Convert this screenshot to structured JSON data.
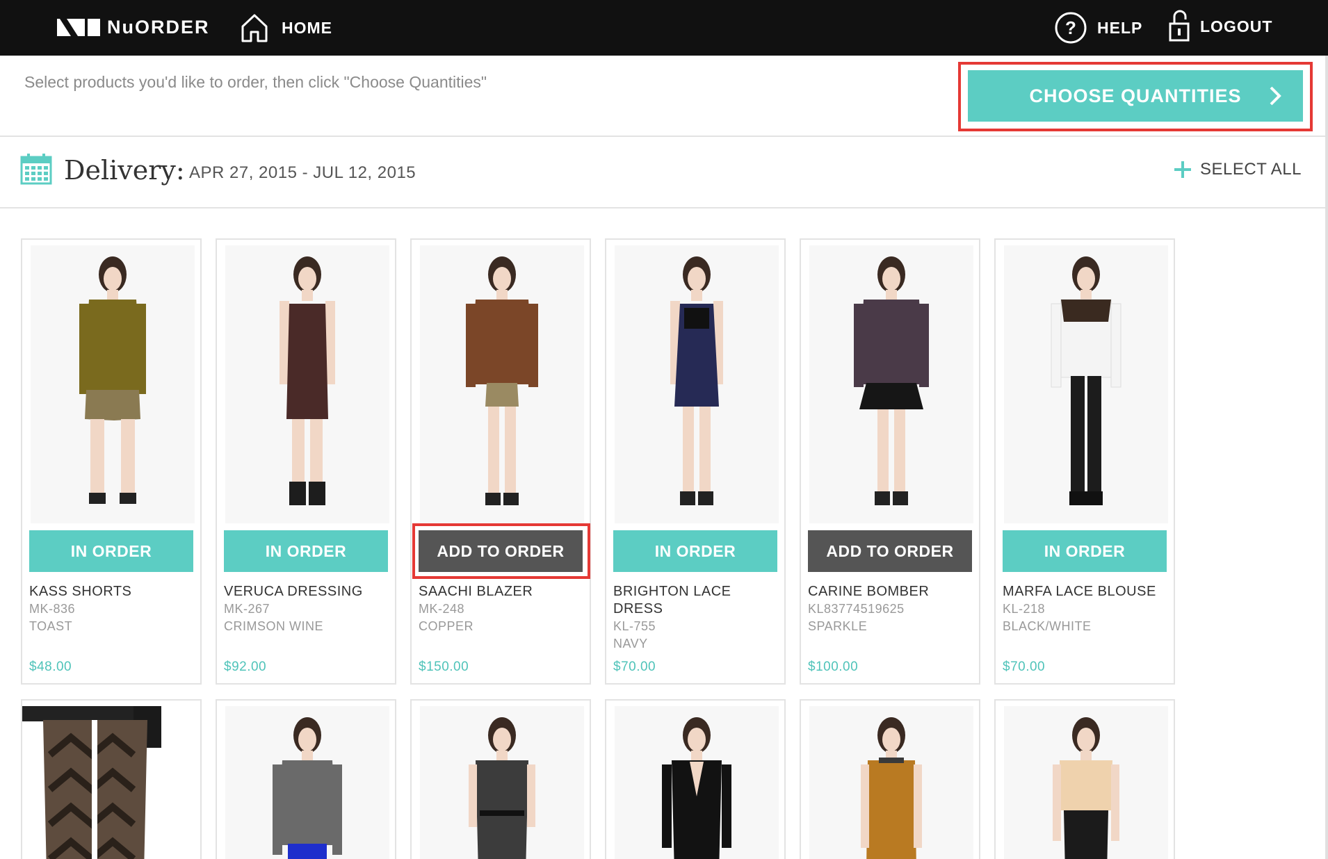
{
  "nav": {
    "brand_prefix": "Nu",
    "brand_suffix": "ORDER",
    "home_label": "HOME",
    "help_label": "HELP",
    "logout_label": "LOGOUT"
  },
  "toolbar": {
    "instruction": "Select products you'd like to order, then click \"Choose Quantities\"",
    "choose_quantities_label": "CHOOSE QUANTITIES"
  },
  "delivery": {
    "label": "Delivery:",
    "dates": "APR 27, 2015 - JUL 12, 2015",
    "select_all_label": "SELECT ALL"
  },
  "colors": {
    "accent": "#5ccdc3",
    "add_button": "#555555",
    "highlight": "#e53935",
    "nav_bg": "#111111"
  },
  "products": [
    {
      "name": "KASS SHORTS",
      "sku": "MK-836",
      "color": "TOAST",
      "price": "$48.00",
      "status": "IN ORDER"
    },
    {
      "name": "VERUCA DRESSING",
      "sku": "MK-267",
      "color": "CRIMSON WINE",
      "price": "$92.00",
      "status": "IN ORDER"
    },
    {
      "name": "SAACHI BLAZER",
      "sku": "MK-248",
      "color": "COPPER",
      "price": "$150.00",
      "status": "ADD TO ORDER"
    },
    {
      "name": "BRIGHTON LACE DRESS",
      "sku": "KL-755",
      "color": "NAVY",
      "price": "$70.00",
      "status": "IN ORDER"
    },
    {
      "name": "CARINE BOMBER",
      "sku": "KL83774519625",
      "color": "SPARKLE",
      "price": "$100.00",
      "status": "ADD TO ORDER"
    },
    {
      "name": "MARFA LACE BLOUSE",
      "sku": "KL-218",
      "color": "BLACK/WHITE",
      "price": "$70.00",
      "status": "IN ORDER"
    }
  ]
}
